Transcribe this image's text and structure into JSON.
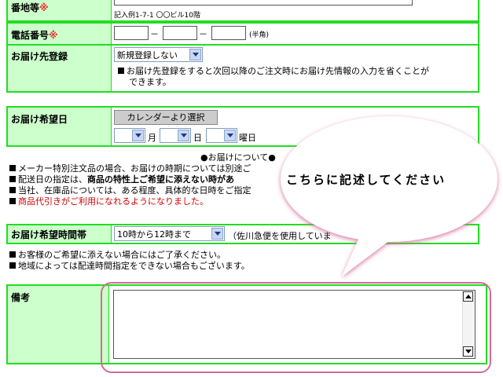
{
  "address": {
    "label": "番地等",
    "required_mark": "※",
    "example": "記入例1-7-1 〇〇ビル10階"
  },
  "phone": {
    "label": "電話番号",
    "required_mark": "※",
    "dash1": "－",
    "dash2": "－",
    "note": "(半角)"
  },
  "delivery_register": {
    "label": "お届け先登録",
    "select_value": "新規登録しない",
    "note_line1": "お届け先登録をすると次回以降のご注文時にお届け先情報の入力を省くことが",
    "note_line2": "できます。"
  },
  "delivery_date": {
    "label": "お届け希望日",
    "calendar_button": "カレンダーより選択",
    "month": "月",
    "day": "日",
    "weekday": "曜日"
  },
  "date_notes": {
    "center_heading": "●お届けについて●",
    "line1": "メーカー特別注文品の場合、お届けの時期については別途ご",
    "line2_pre": "配送日の指定は、",
    "line2_bold": "商品の特性上ご希望に添えない時があ",
    "line3": "当社、在庫品については、ある程度、具体的な日時をご指定",
    "line4": "商品代引きがご利用になれるようになりました。"
  },
  "delivery_time": {
    "label": "お届け希望時間帯",
    "select_value": "10時から12時まで",
    "note": "（佐川急便を使用していま"
  },
  "time_notes": {
    "line1": "お客様のご希望に添えない場合にはご了承ください。",
    "line2": "地域によっては配達時間指定をできない場合もございます。"
  },
  "remarks": {
    "label": "備考"
  },
  "callout": {
    "text": "こちらに記述してください"
  },
  "colors": {
    "border_green": "#22dd22",
    "label_bg": "#ccffcc",
    "required_red": "#ee3333",
    "callout_outline": "#d46a9a",
    "notice_red": "#cc0000"
  }
}
